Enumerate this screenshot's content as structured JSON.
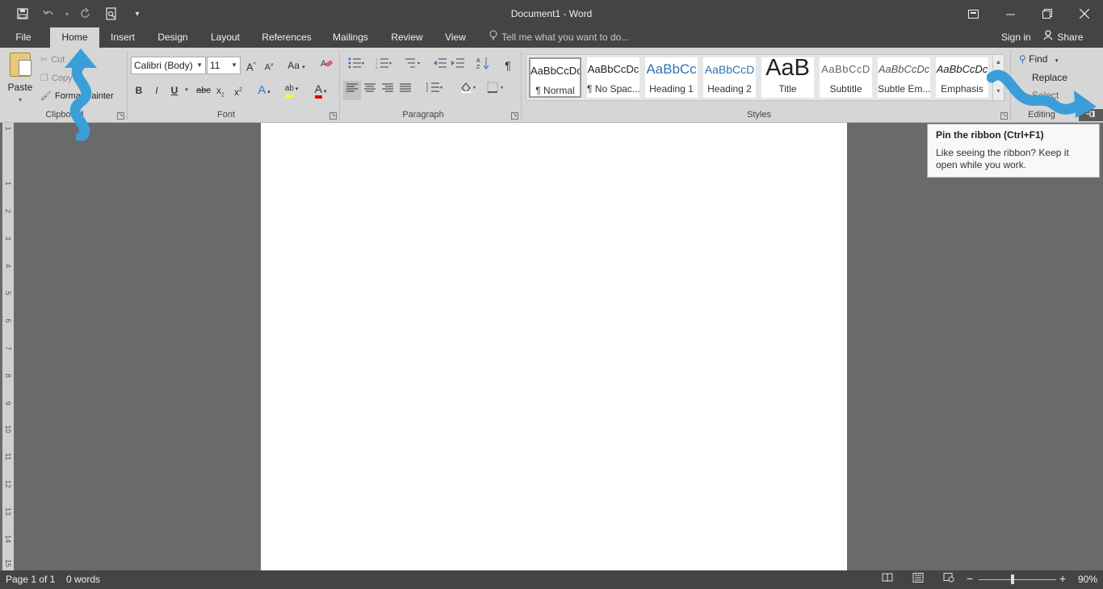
{
  "window": {
    "title": "Document1 - Word",
    "qat_icons": [
      "save-icon",
      "undo-icon",
      "undo-dropdown-icon",
      "redo-icon",
      "print-preview-icon",
      "customize-qat-icon"
    ],
    "controls": [
      "ribbon-display-options-icon",
      "minimize-icon",
      "restore-icon",
      "close-icon"
    ]
  },
  "tabs": [
    "File",
    "Home",
    "Insert",
    "Design",
    "Layout",
    "References",
    "Mailings",
    "Review",
    "View"
  ],
  "active_tab": "Home",
  "tell_me": "Tell me what you want to do...",
  "sign_in": "Sign in",
  "share": "Share",
  "clipboard": {
    "paste": "Paste",
    "cut": "Cut",
    "copy": "Copy",
    "format_painter": "Format Painter",
    "label": "Clipboard"
  },
  "font": {
    "name": "Calibri (Body)",
    "size": "11",
    "label": "Font",
    "buttons": {
      "grow": "A",
      "shrink": "A",
      "case": "Aa",
      "bold": "B",
      "italic": "I",
      "underline": "U",
      "strike": "abc",
      "subscript": "x",
      "superscript": "x",
      "text_effects": "A",
      "highlight": "ab",
      "font_color": "A"
    }
  },
  "paragraph": {
    "label": "Paragraph",
    "pilcrow": "¶"
  },
  "styles": {
    "label": "Styles",
    "items": [
      {
        "preview": "AaBbCcDc",
        "name": "¶ Normal"
      },
      {
        "preview": "AaBbCcDc",
        "name": "¶ No Spac..."
      },
      {
        "preview": "AaBbCc",
        "name": "Heading 1"
      },
      {
        "preview": "AaBbCcD",
        "name": "Heading 2"
      },
      {
        "preview": "AaB",
        "name": "Title"
      },
      {
        "preview": "AaBbCcD",
        "name": "Subtitle"
      },
      {
        "preview": "AaBbCcDc",
        "name": "Subtle Em..."
      },
      {
        "preview": "AaBbCcDc",
        "name": "Emphasis"
      }
    ]
  },
  "editing": {
    "find": "Find",
    "replace": "Replace",
    "select": "Select",
    "label": "Editing"
  },
  "tooltip": {
    "title": "Pin the ribbon (Ctrl+F1)",
    "body": "Like seeing the ribbon? Keep it open while you work."
  },
  "ruler_numbers": [
    "1",
    "1",
    "2",
    "3",
    "4",
    "5",
    "6",
    "7",
    "8",
    "9",
    "10",
    "11",
    "12",
    "13",
    "14",
    "15"
  ],
  "status": {
    "page": "Page 1 of 1",
    "words": "0 words",
    "zoom": "90%"
  },
  "colors": {
    "titlebar": "#444444",
    "ribbon": "#d6d6d6",
    "workspace": "#6a6a6a",
    "annotation_arrow": "#3a9fd8",
    "highlight_yellow": "#ffff00",
    "font_color_red": "#e00000"
  }
}
